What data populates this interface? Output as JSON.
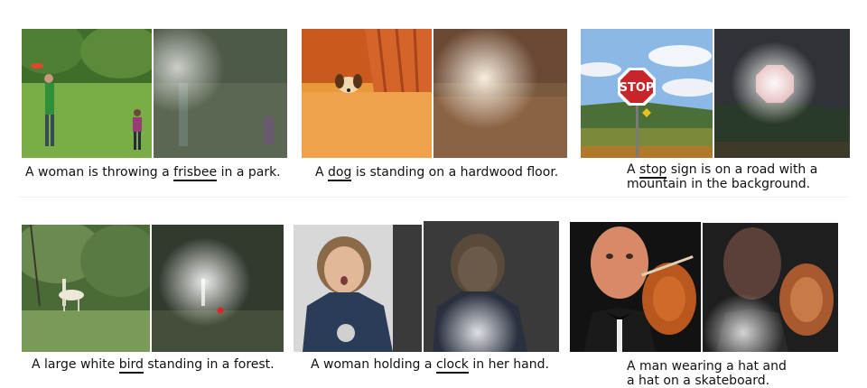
{
  "figure": {
    "panels": [
      {
        "caption_pre": "A woman is throwing a ",
        "caption_word": "frisbee",
        "caption_post": " in a park.",
        "caption_line2": ""
      },
      {
        "caption_pre": "A ",
        "caption_word": "dog",
        "caption_post": " is standing on a hardwood floor.",
        "caption_line2": ""
      },
      {
        "caption_pre": "A ",
        "caption_word": "stop",
        "caption_post": " sign is on a road with a",
        "caption_line2": "mountain in the background."
      },
      {
        "caption_pre": "A large white ",
        "caption_word": "bird",
        "caption_post": " standing in a forest.",
        "caption_line2": ""
      },
      {
        "caption_pre": "A woman holding a ",
        "caption_word": "clock",
        "caption_post": " in her hand.",
        "caption_line2": ""
      },
      {
        "caption_pre": "A man wearing a hat and",
        "caption_word": "",
        "caption_post": "",
        "caption_line2": "a hat on a skateboard."
      }
    ],
    "stop_sign_text": "STOP"
  }
}
